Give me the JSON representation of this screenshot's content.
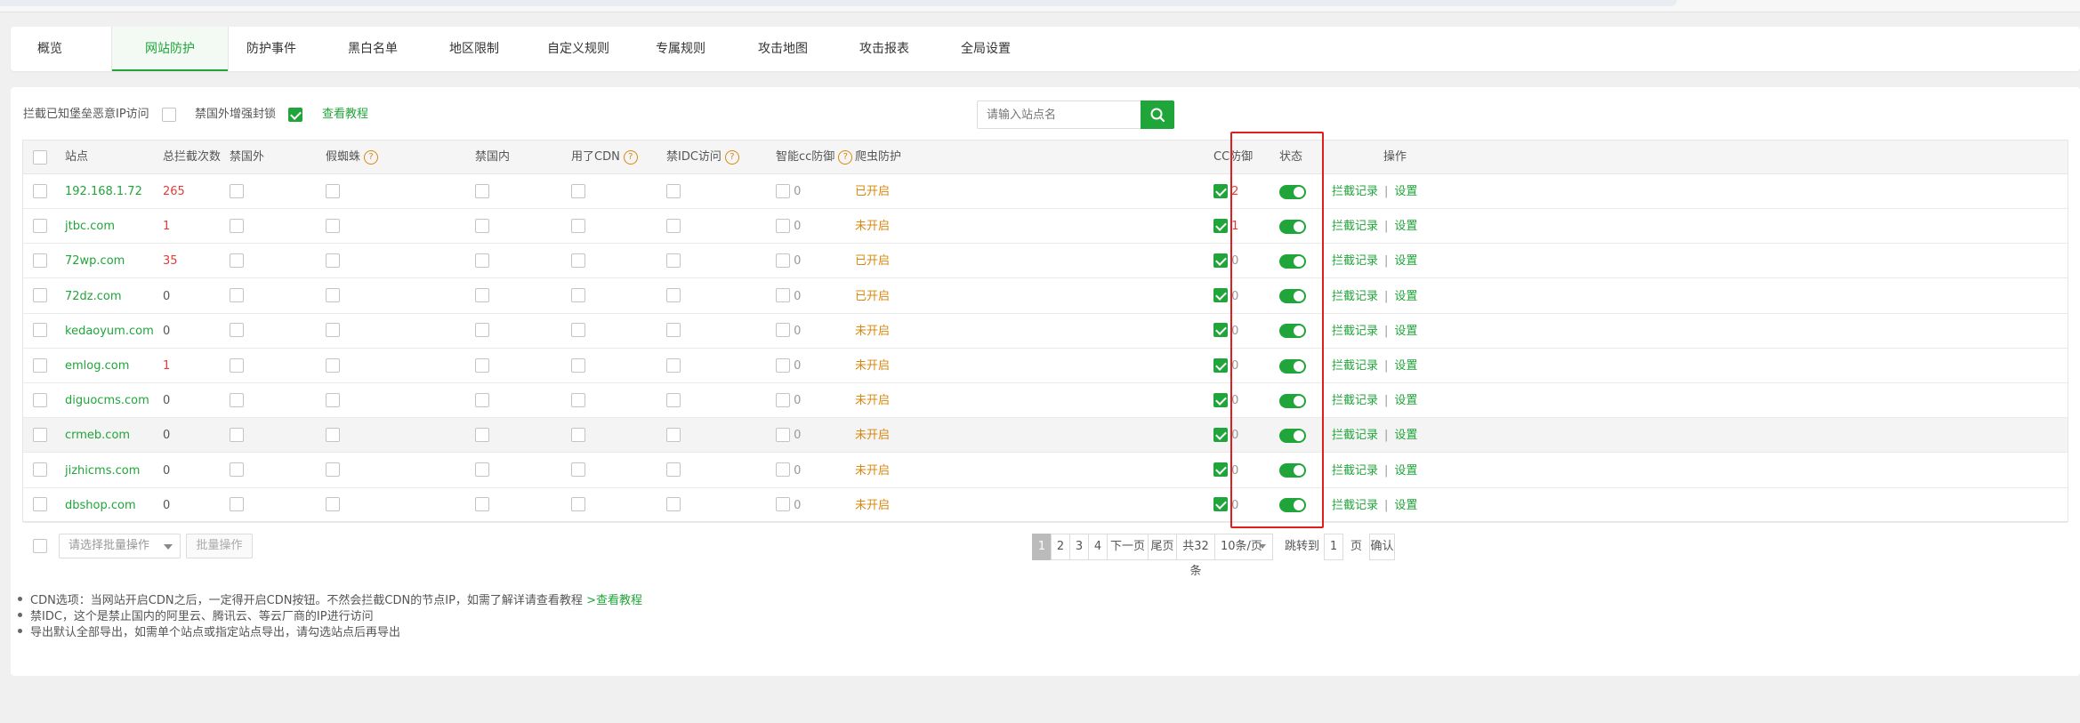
{
  "tabs": [
    "概览",
    "网站防护",
    "防护事件",
    "黑白名单",
    "地区限制",
    "自定义规则",
    "专属规则",
    "攻击地图",
    "攻击报表",
    "全局设置"
  ],
  "active_tab": "网站防护",
  "toolbar": {
    "block_malicious_label": "拦截已知堡垒恶意IP访问",
    "block_foreign_label": "禁国外增强封锁",
    "tutorial_link": "查看教程",
    "search_placeholder": "请输入站点名"
  },
  "table": {
    "headers": {
      "site": "站点",
      "total_blocks": "总拦截次数",
      "ban_foreign": "禁国外",
      "fake_spider": "假蜘蛛",
      "ban_domestic": "禁国内",
      "used_cdn": "用了CDN",
      "ban_idc": "禁IDC访问",
      "smart_cc": "智能cc防御",
      "crawler": "爬虫防护",
      "cc_defense": "CC防御",
      "status": "状态",
      "actions": "操作"
    },
    "rows": [
      {
        "site": "192.168.1.72",
        "total": "265",
        "smart_cc": "0",
        "crawler": "已开启",
        "cc": "2"
      },
      {
        "site": "jtbc.com",
        "total": "1",
        "smart_cc": "0",
        "crawler": "未开启",
        "cc": "1"
      },
      {
        "site": "72wp.com",
        "total": "35",
        "smart_cc": "0",
        "crawler": "已开启",
        "cc": "0"
      },
      {
        "site": "72dz.com",
        "total": "0",
        "smart_cc": "0",
        "crawler": "已开启",
        "cc": "0"
      },
      {
        "site": "kedaoyum.com",
        "total": "0",
        "smart_cc": "0",
        "crawler": "未开启",
        "cc": "0"
      },
      {
        "site": "emlog.com",
        "total": "1",
        "smart_cc": "0",
        "crawler": "未开启",
        "cc": "0"
      },
      {
        "site": "diguocms.com",
        "total": "0",
        "smart_cc": "0",
        "crawler": "未开启",
        "cc": "0"
      },
      {
        "site": "crmeb.com",
        "total": "0",
        "smart_cc": "0",
        "crawler": "未开启",
        "cc": "0"
      },
      {
        "site": "jizhicms.com",
        "total": "0",
        "smart_cc": "0",
        "crawler": "未开启",
        "cc": "0"
      },
      {
        "site": "dbshop.com",
        "total": "0",
        "smart_cc": "0",
        "crawler": "未开启",
        "cc": "0"
      }
    ],
    "action_log": "拦截记录",
    "action_settings": "设置"
  },
  "batch": {
    "select_placeholder": "请选择批量操作",
    "button": "批量操作"
  },
  "pagination": {
    "pages": [
      "1",
      "2",
      "3",
      "4"
    ],
    "current": "1",
    "next": "下一页",
    "last": "尾页",
    "total": "共32条",
    "per_page": "10条/页",
    "goto_label": "跳转到",
    "goto_value": "1",
    "page_unit": "页",
    "confirm": "确认"
  },
  "notes": {
    "cdn": "CDN选项：当网站开启CDN之后，一定得开启CDN按钮。不然会拦截CDN的节点IP，如需了解详请查看教程",
    "cdn_link": ">查看教程",
    "idc": "禁IDC，这个是禁止国内的阿里云、腾讯云、等云厂商的IP进行访问",
    "export": "导出默认全部导出，如需单个站点或指定站点导出，请勾选站点后再导出"
  },
  "colors": {
    "accent": "#20a53a",
    "count_red": "#e23c3c",
    "status_orange": "#d9880f",
    "highlight_red": "#e01e1e"
  }
}
